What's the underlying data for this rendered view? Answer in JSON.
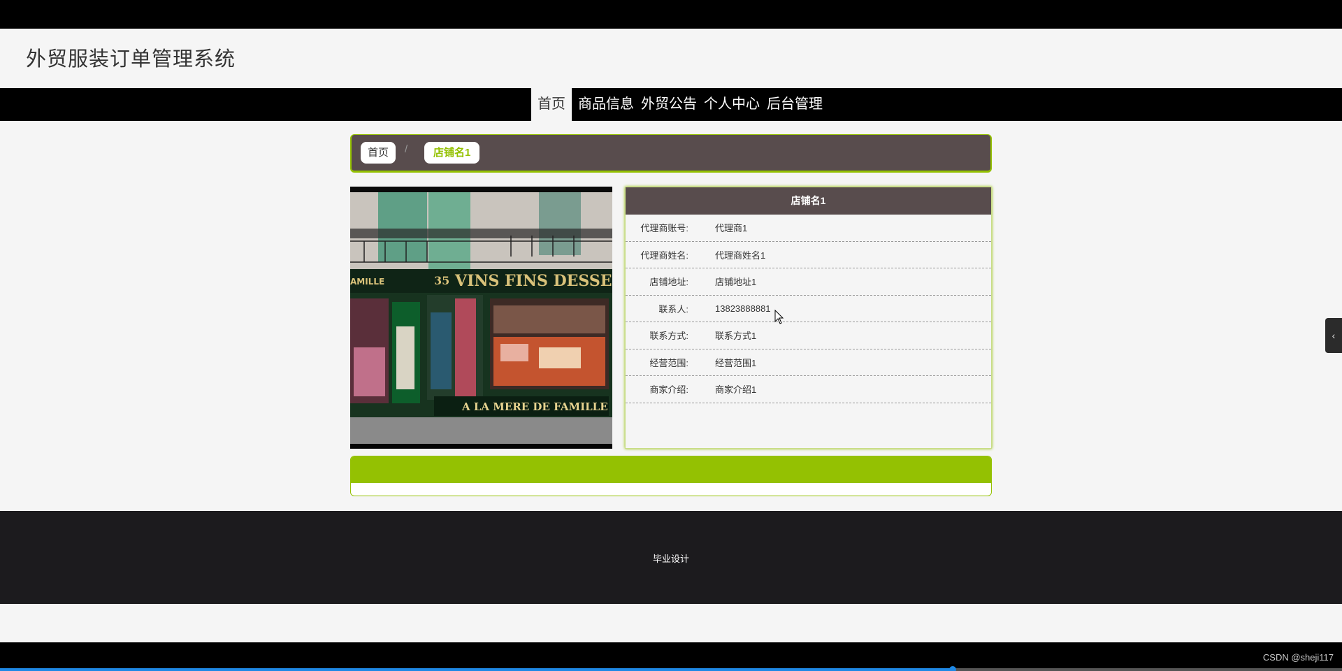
{
  "site": {
    "title": "外贸服装订单管理系统"
  },
  "nav": {
    "items": [
      "首页",
      "商品信息",
      "外贸公告",
      "个人中心",
      "后台管理"
    ]
  },
  "breadcrumb": {
    "home": "首页",
    "separator": "/",
    "current": "店铺名1"
  },
  "shop": {
    "name": "店铺名1",
    "fields": [
      {
        "label": "代理商账号:",
        "value": "代理商1"
      },
      {
        "label": "代理商姓名:",
        "value": "代理商姓名1"
      },
      {
        "label": "店铺地址:",
        "value": "店铺地址1"
      },
      {
        "label": "联系人:",
        "value": "13823888881"
      },
      {
        "label": "联系方式:",
        "value": "联系方式1"
      },
      {
        "label": "经营范围:",
        "value": "经营范围1"
      },
      {
        "label": "商家介绍:",
        "value": "商家介绍1"
      }
    ]
  },
  "footer": {
    "text": "毕业设计"
  },
  "side_tab": {
    "icon": "chevron-left-icon",
    "glyph": "‹"
  },
  "video": {
    "progress": 0.71
  },
  "watermark": "CSDN @sheji117",
  "colors": {
    "accent": "#94c102",
    "header_dark": "#584c4d",
    "footer": "#1c1b1e"
  }
}
